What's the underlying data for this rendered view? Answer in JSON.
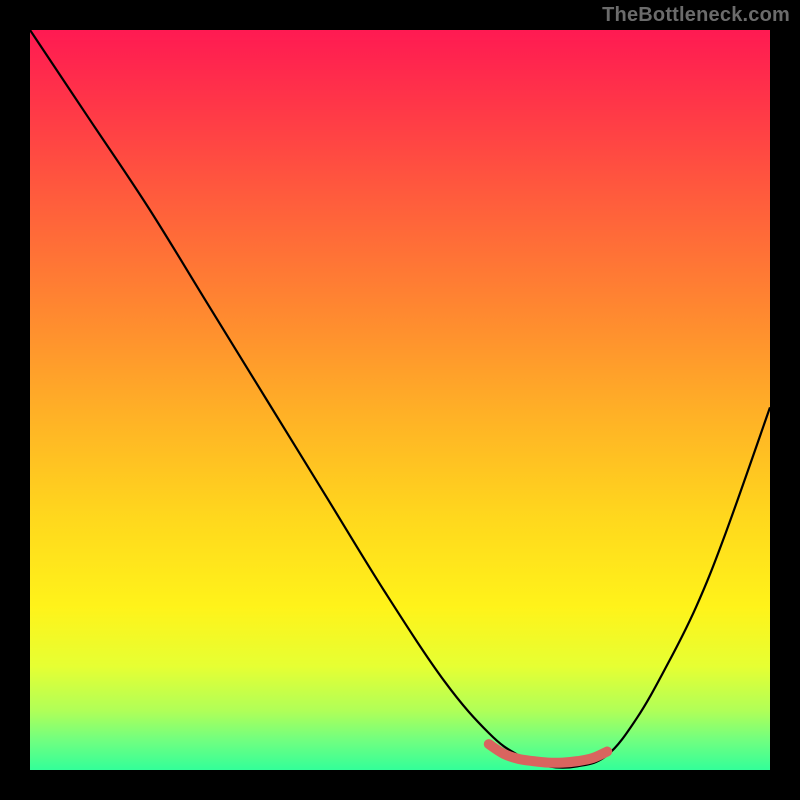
{
  "watermark": "TheBottleneck.com",
  "colors": {
    "page_bg": "#000000",
    "gradient_top": "#ff1a52",
    "gradient_bottom": "#33ff99",
    "curve": "#000000",
    "flat_mark": "#d9645f"
  },
  "chart_data": {
    "type": "line",
    "title": "",
    "xlabel": "",
    "ylabel": "",
    "xlim": [
      0,
      100
    ],
    "ylim": [
      0,
      100
    ],
    "grid": false,
    "series": [
      {
        "name": "bottleneck-curve",
        "x": [
          0,
          8,
          16,
          24,
          32,
          40,
          48,
          56,
          62,
          66,
          70,
          74,
          78,
          82,
          86,
          90,
          94,
          100
        ],
        "y": [
          100,
          88,
          76,
          63,
          50,
          37,
          24,
          12,
          5,
          2,
          0.5,
          0.5,
          2,
          7,
          14,
          22,
          32,
          49
        ]
      },
      {
        "name": "optimal-band",
        "x": [
          62,
          64,
          66,
          68,
          70,
          72,
          74,
          76,
          78
        ],
        "y": [
          3.5,
          2.2,
          1.5,
          1.2,
          1.0,
          1.0,
          1.2,
          1.6,
          2.5
        ]
      }
    ],
    "annotations": []
  }
}
